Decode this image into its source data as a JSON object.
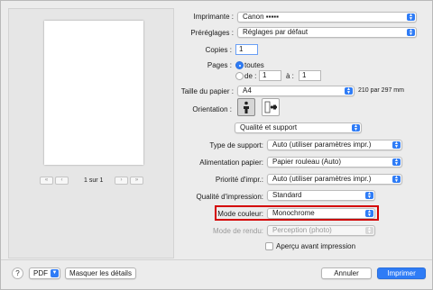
{
  "preview": {
    "page_indicator": "1 sur 1",
    "first_icon": "double-chevron-left",
    "prev_icon": "chevron-left",
    "next_icon": "chevron-right",
    "last_icon": "double-chevron-right"
  },
  "printer": {
    "label": "Imprimante :",
    "value": "Canon ▪▪▪▪▪"
  },
  "presets": {
    "label": "Préréglages :",
    "value": "Réglages par défaut"
  },
  "copies": {
    "label": "Copies :",
    "value": "1"
  },
  "pages": {
    "label": "Pages :",
    "all_label": "toutes",
    "from_label": "de :",
    "from_value": "1",
    "to_label": "à :",
    "to_value": "1",
    "selected": "toutes"
  },
  "paper_size": {
    "label": "Taille du papier :",
    "value": "A4",
    "dimensions": "210 par 297 mm"
  },
  "orientation": {
    "label": "Orientation :",
    "portrait_icon": "portrait-icon",
    "landscape_icon": "landscape-icon",
    "selected": "portrait"
  },
  "section": {
    "value": "Qualité et support"
  },
  "media_type": {
    "label": "Type de support:",
    "value": "Auto (utiliser paramètres impr.)"
  },
  "paper_source": {
    "label": "Alimentation papier:",
    "value": "Papier rouleau (Auto)"
  },
  "print_priority": {
    "label": "Priorité d'impr.:",
    "value": "Auto (utiliser paramètres impr.)"
  },
  "print_quality": {
    "label": "Qualité d'impression:",
    "value": "Standard"
  },
  "color_mode": {
    "label": "Mode couleur:",
    "value": "Monochrome",
    "highlight_color": "#d40000"
  },
  "render_mode": {
    "label": "Mode de rendu:",
    "value": "Perception (photo)"
  },
  "preview_check": {
    "label": "Aperçu avant impression",
    "checked": false
  },
  "footer": {
    "help": "?",
    "pdf": "PDF",
    "hide_details": "Masquer les détails",
    "cancel": "Annuler",
    "print": "Imprimer"
  },
  "colors": {
    "accent": "#2f7cf6",
    "background": "#ececec"
  }
}
